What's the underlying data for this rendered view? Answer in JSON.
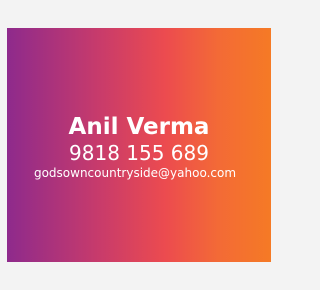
{
  "contact_card": {
    "name": "Anil Verma",
    "phone": "9818 155 689",
    "email": "godsowncountryside@yahoo.com"
  },
  "colors": {
    "page_background": "#f3f3f3",
    "gradient_start": "#8e2a8c",
    "gradient_end": "#f57a25",
    "text": "#ffffff"
  }
}
